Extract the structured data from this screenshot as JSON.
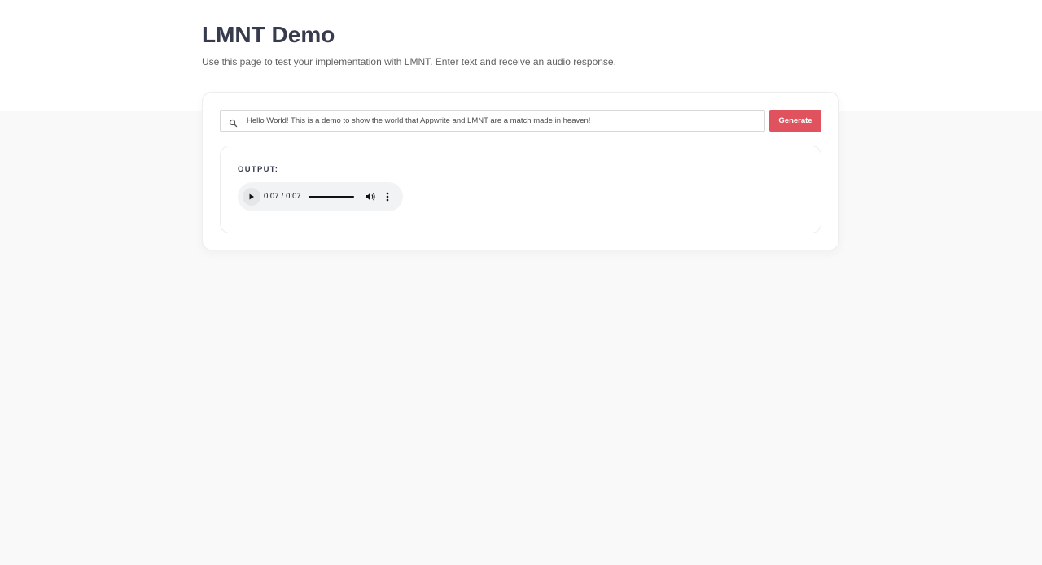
{
  "page": {
    "title": "LMNT Demo",
    "subtitle": "Use this page to test your implementation with LMNT. Enter text and receive an audio response."
  },
  "search": {
    "icon": "search-icon",
    "value": "Hello World! This is a demo to show the world that Appwrite and LMNT are a match made in heaven!"
  },
  "generate": {
    "label": "Generate",
    "color": "#e0535e"
  },
  "output": {
    "label": "OUTPUT:",
    "audio": {
      "current_time": "0:07",
      "duration": "0:07",
      "progress": 1.0,
      "play_icon": "play-icon",
      "volume_icon": "volume-icon",
      "more_icon": "more-vertical-icon"
    }
  }
}
